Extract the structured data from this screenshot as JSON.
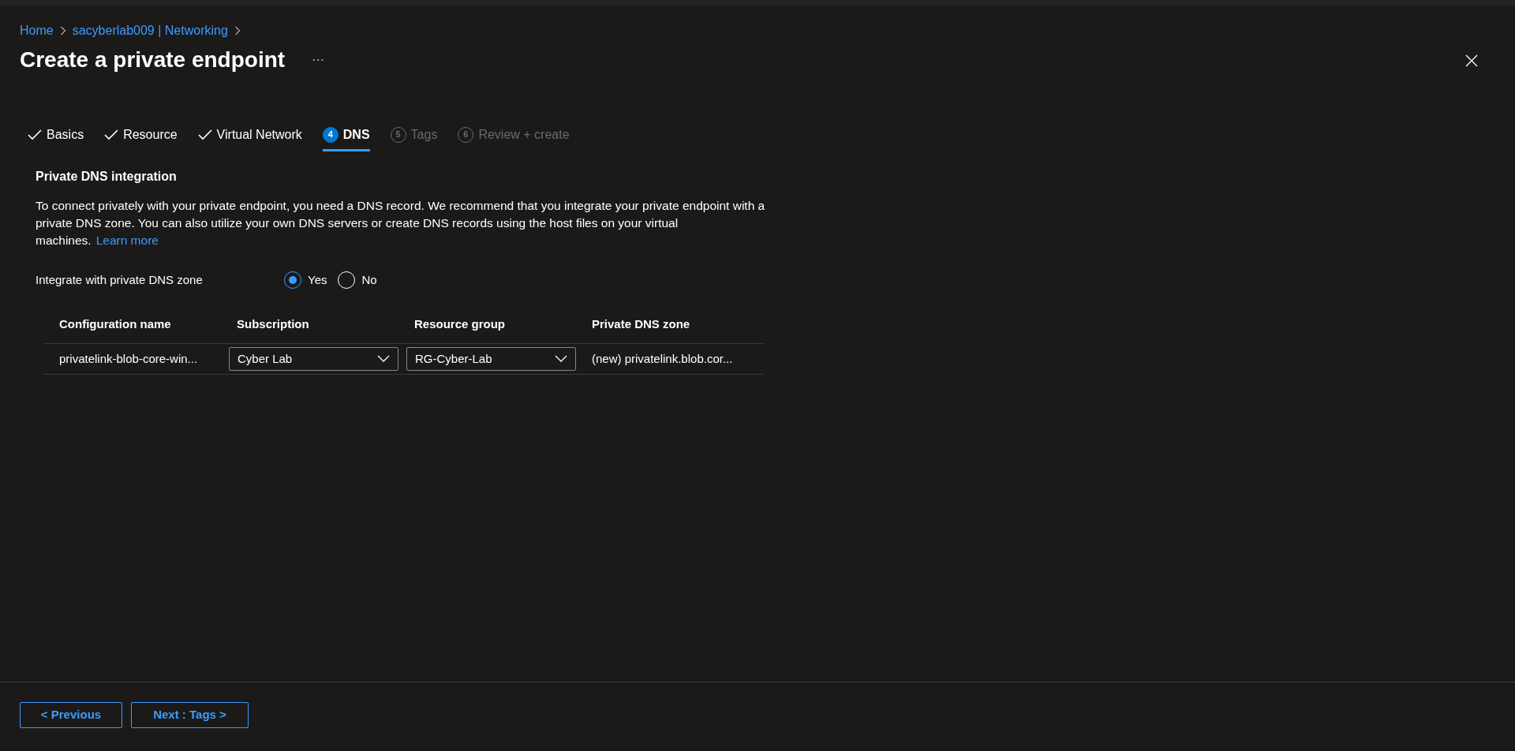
{
  "breadcrumb": [
    "Home",
    "sacyberlab009 | Networking"
  ],
  "title": "Create a private endpoint",
  "more_button": "···",
  "tabs": [
    {
      "kind": "done",
      "label": "Basics",
      "selected": false,
      "disabled": false
    },
    {
      "kind": "done",
      "label": "Resource",
      "selected": false,
      "disabled": false
    },
    {
      "kind": "done",
      "label": "Virtual Network",
      "selected": false,
      "disabled": false
    },
    {
      "kind": "numbered",
      "number": "4",
      "label": "DNS",
      "selected": true,
      "disabled": false
    },
    {
      "kind": "numbered",
      "number": "5",
      "label": "Tags",
      "selected": false,
      "disabled": true
    },
    {
      "kind": "numbered",
      "number": "6",
      "label": "Review + create",
      "selected": false,
      "disabled": true
    }
  ],
  "section": {
    "heading": "Private DNS integration",
    "description": "To connect privately with your private endpoint, you need a DNS record. We recommend that you integrate your private endpoint with a private DNS zone. You can also utilize your own DNS servers or create DNS records using the host files on your virtual machines.",
    "link": "Learn more"
  },
  "integrate": {
    "label": "Integrate with private DNS zone",
    "options": [
      {
        "label": "Yes",
        "selected": true
      },
      {
        "label": "No",
        "selected": false
      }
    ]
  },
  "table": {
    "columns": [
      "Configuration name",
      "Subscription",
      "Resource group",
      "Private DNS zone"
    ],
    "rows": [
      {
        "configuration_name": "privatelink-blob-core-win...",
        "subscription": "Cyber Lab",
        "resource_group": "RG-Cyber-Lab",
        "private_dns_zone": "(new) privatelink.blob.cor..."
      }
    ]
  },
  "footer": {
    "buttons": [
      "< Previous",
      "Next : Tags >"
    ]
  }
}
